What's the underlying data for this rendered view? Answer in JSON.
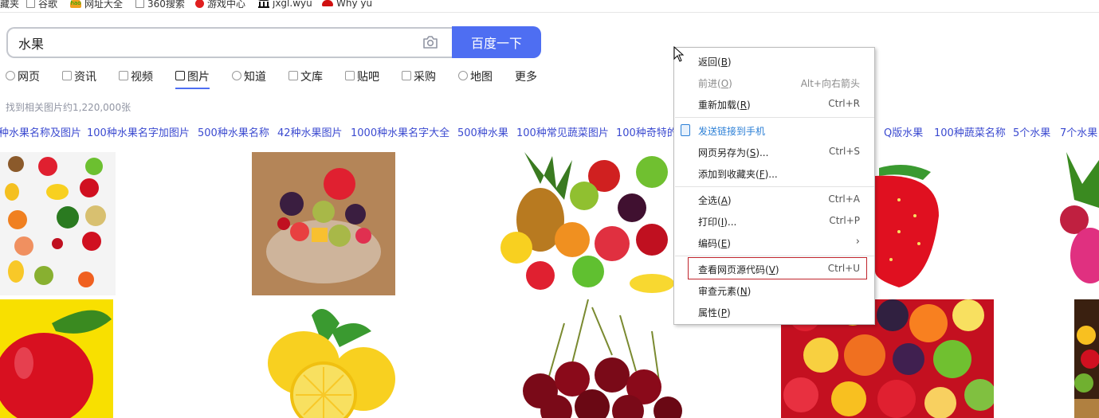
{
  "bookmarks": [
    {
      "label": "藏夹",
      "icon": "none"
    },
    {
      "label": "谷歌",
      "icon": "page-icon"
    },
    {
      "label": "网址大全",
      "icon": "hao123-icon"
    },
    {
      "label": "360搜索",
      "icon": "page-icon"
    },
    {
      "label": "游戏中心",
      "icon": "game-icon"
    },
    {
      "label": "jxgl.wyu",
      "icon": "bank-icon"
    },
    {
      "label": "Why yu",
      "icon": "hat-icon"
    }
  ],
  "search": {
    "value": "水果",
    "button_label": "百度一下",
    "camera_icon": "camera-icon"
  },
  "tabs": [
    {
      "label": "网页",
      "icon": "search-icon"
    },
    {
      "label": "资讯",
      "icon": "news-icon"
    },
    {
      "label": "视频",
      "icon": "video-icon"
    },
    {
      "label": "图片",
      "icon": "image-icon",
      "active": true
    },
    {
      "label": "知道",
      "icon": "question-icon"
    },
    {
      "label": "文库",
      "icon": "doc-icon"
    },
    {
      "label": "贴吧",
      "icon": "tieba-icon"
    },
    {
      "label": "采购",
      "icon": "cart-icon"
    },
    {
      "label": "地图",
      "icon": "map-icon"
    },
    {
      "label": "更多",
      "icon": "none"
    }
  ],
  "result_count": "找到相关图片约1,220,000张",
  "related": [
    "种水果名称及图片",
    "100种水果名字加图片",
    "500种水果名称",
    "42种水果图片",
    "1000种水果名字大全",
    "500种水果",
    "100种常见蔬菜图片",
    "100种奇特的",
    "Q版水果",
    "100种蔬菜名称",
    "5个水果",
    "7个水果"
  ],
  "images": [
    {
      "name": "fruit-collage-image",
      "desc": "assorted fruits"
    },
    {
      "name": "fruit-salad-bowl-image",
      "desc": "fruit salad"
    },
    {
      "name": "fruit-pile-image",
      "desc": "pineapple and fruits"
    },
    {
      "name": "strawberry-image",
      "desc": "strawberry"
    },
    {
      "name": "dragonfruit-image",
      "desc": "dragon fruit"
    },
    {
      "name": "apple-image",
      "desc": "red apple"
    },
    {
      "name": "lemon-image",
      "desc": "lemons"
    },
    {
      "name": "cherry-image",
      "desc": "cherries"
    },
    {
      "name": "fruit-mix-image",
      "desc": "mixed fruits"
    },
    {
      "name": "fruit-basket-image",
      "desc": "fruit basket"
    }
  ],
  "context_menu": {
    "items": [
      {
        "label": "返回(",
        "key": "B",
        "tail": ")",
        "shortcut": ""
      },
      {
        "label": "前进(",
        "key": "O",
        "tail": ")",
        "shortcut": "Alt+向右箭头",
        "disabled": true
      },
      {
        "label": "重新加载(",
        "key": "R",
        "tail": ")",
        "shortcut": "Ctrl+R"
      },
      {
        "label": "发送链接到手机",
        "key": "",
        "tail": "",
        "shortcut": ""
      },
      {
        "label": "网页另存为(",
        "key": "S",
        "tail": ")...",
        "shortcut": "Ctrl+S"
      },
      {
        "label": "添加到收藏夹(",
        "key": "F",
        "tail": ")...",
        "shortcut": ""
      },
      {
        "label": "全选(",
        "key": "A",
        "tail": ")",
        "shortcut": "Ctrl+A"
      },
      {
        "label": "打印(",
        "key": "I",
        "tail": ")...",
        "shortcut": "Ctrl+P"
      },
      {
        "label": "编码(",
        "key": "E",
        "tail": ")",
        "shortcut": "",
        "submenu": true
      },
      {
        "label": "查看网页源代码(",
        "key": "V",
        "tail": ")",
        "shortcut": "Ctrl+U",
        "highlighted": true
      },
      {
        "label": "审查元素(",
        "key": "N",
        "tail": ")",
        "shortcut": ""
      },
      {
        "label": "属性(",
        "key": "P",
        "tail": ")",
        "shortcut": ""
      }
    ]
  },
  "colors": {
    "accent": "#4e6ef2",
    "link": "#3b4ad0",
    "highlight_border": "#c0242c"
  }
}
